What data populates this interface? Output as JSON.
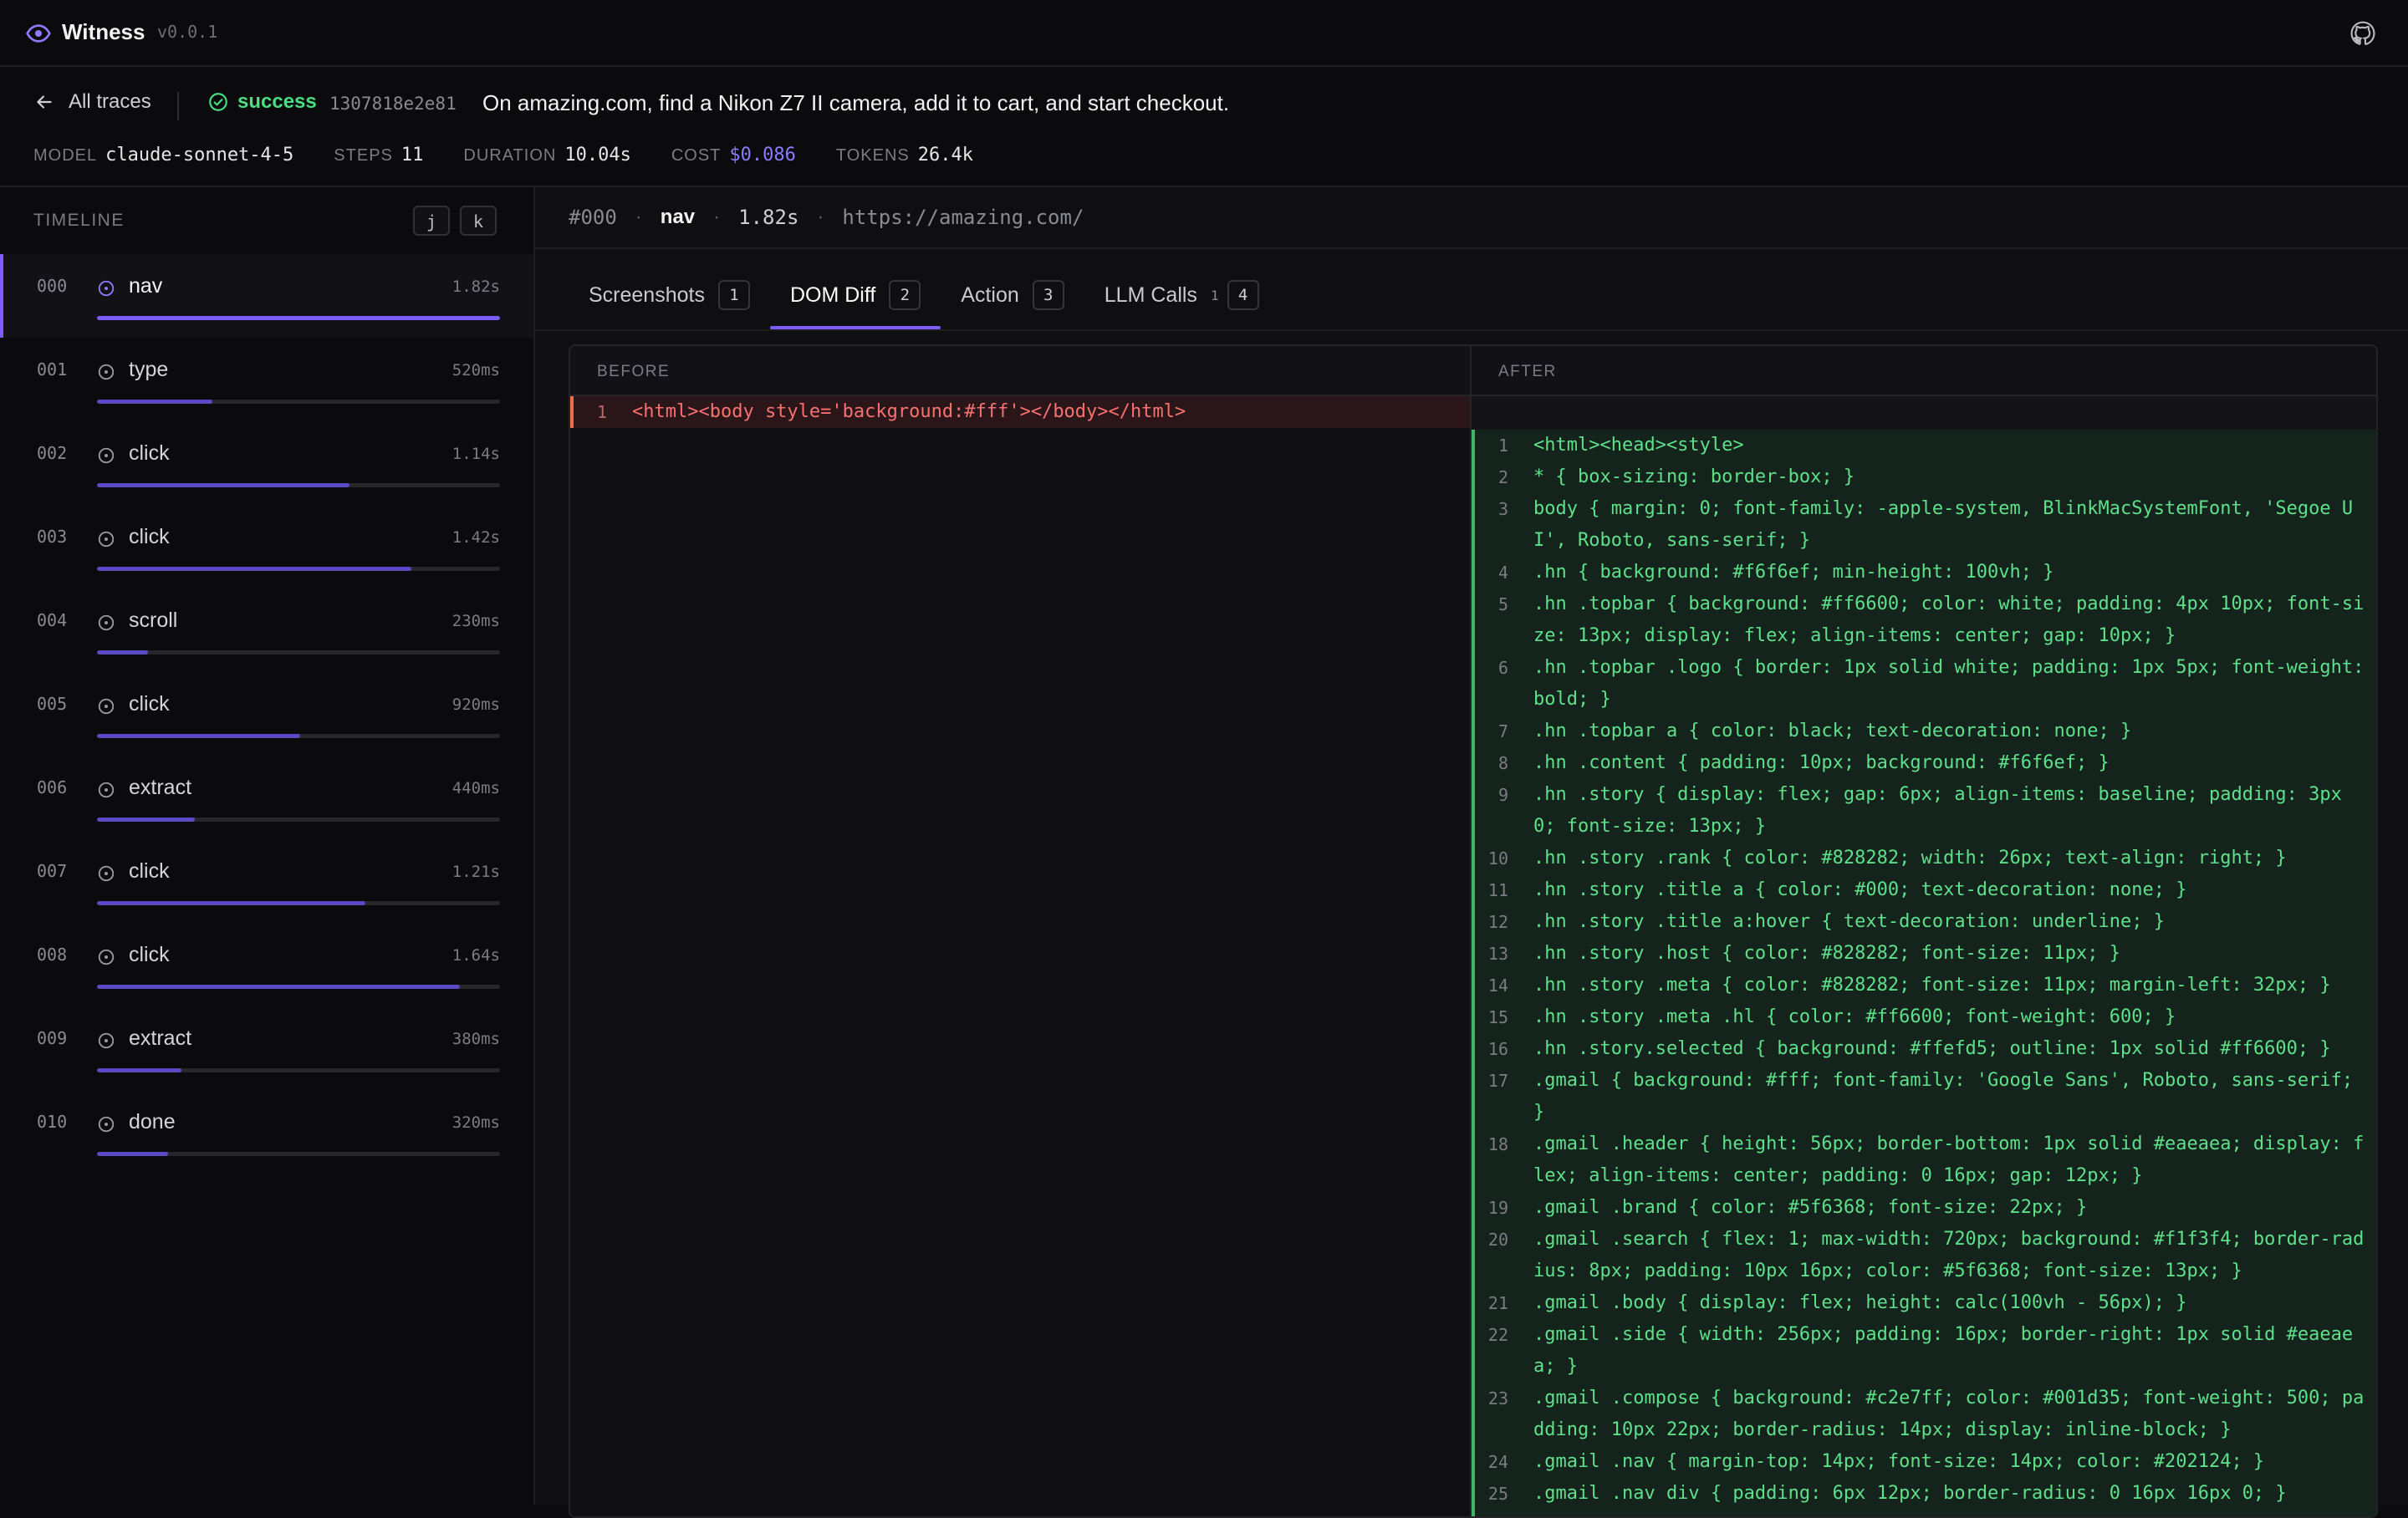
{
  "app": {
    "title": "Witness",
    "version": "v0.0.1"
  },
  "header": {
    "back_label": "All traces",
    "status": "success",
    "trace_id": "1307818e2e81",
    "task": "On amazing.com, find a Nikon Z7 II camera, add it to cart, and start checkout.",
    "stats": {
      "model_key": "MODEL",
      "model": "claude-sonnet-4-5",
      "steps_key": "STEPS",
      "steps": "11",
      "duration_key": "DURATION",
      "duration": "10.04s",
      "cost_key": "COST",
      "cost": "$0.086",
      "tokens_key": "TOKENS",
      "tokens": "26.4k"
    }
  },
  "timeline": {
    "title": "TIMELINE",
    "keys": [
      "j",
      "k"
    ],
    "steps": [
      {
        "index": "000",
        "label": "nav",
        "duration": "1.82s",
        "progress": 1.0
      },
      {
        "index": "001",
        "label": "type",
        "duration": "520ms",
        "progress": 0.286
      },
      {
        "index": "002",
        "label": "click",
        "duration": "1.14s",
        "progress": 0.626
      },
      {
        "index": "003",
        "label": "click",
        "duration": "1.42s",
        "progress": 0.78
      },
      {
        "index": "004",
        "label": "scroll",
        "duration": "230ms",
        "progress": 0.126
      },
      {
        "index": "005",
        "label": "click",
        "duration": "920ms",
        "progress": 0.505
      },
      {
        "index": "006",
        "label": "extract",
        "duration": "440ms",
        "progress": 0.242
      },
      {
        "index": "007",
        "label": "click",
        "duration": "1.21s",
        "progress": 0.665
      },
      {
        "index": "008",
        "label": "click",
        "duration": "1.64s",
        "progress": 0.901
      },
      {
        "index": "009",
        "label": "extract",
        "duration": "380ms",
        "progress": 0.209
      },
      {
        "index": "010",
        "label": "done",
        "duration": "320ms",
        "progress": 0.176
      }
    ]
  },
  "detail": {
    "step_id": "#000",
    "action": "nav",
    "duration": "1.82s",
    "url": "https://amazing.com/",
    "separator": "·",
    "tabs": [
      {
        "label": "Screenshots",
        "badge": "1",
        "sub": ""
      },
      {
        "label": "DOM Diff",
        "badge": "2",
        "sub": ""
      },
      {
        "label": "Action",
        "badge": "3",
        "sub": ""
      },
      {
        "label": "LLM Calls",
        "badge": "4",
        "sub": "1"
      }
    ],
    "diff": {
      "before_label": "BEFORE",
      "after_label": "AFTER",
      "before_lines": [
        {
          "n": "1",
          "code": "<html><body style='background:#fff'></body></html>"
        }
      ],
      "after_lines": [
        {
          "n": "1",
          "code": "<html><head><style>"
        },
        {
          "n": "2",
          "code": "* { box-sizing: border-box; }"
        },
        {
          "n": "3",
          "code": "body { margin: 0; font-family: -apple-system, BlinkMacSystemFont, 'Segoe UI', Roboto, sans-serif; }"
        },
        {
          "n": "4",
          "code": ".hn { background: #f6f6ef; min-height: 100vh; }"
        },
        {
          "n": "5",
          "code": ".hn .topbar { background: #ff6600; color: white; padding: 4px 10px; font-size: 13px; display: flex; align-items: center; gap: 10px; }"
        },
        {
          "n": "6",
          "code": ".hn .topbar .logo { border: 1px solid white; padding: 1px 5px; font-weight: bold; }"
        },
        {
          "n": "7",
          "code": ".hn .topbar a { color: black; text-decoration: none; }"
        },
        {
          "n": "8",
          "code": ".hn .content { padding: 10px; background: #f6f6ef; }"
        },
        {
          "n": "9",
          "code": ".hn .story { display: flex; gap: 6px; align-items: baseline; padding: 3px 0; font-size: 13px; }"
        },
        {
          "n": "10",
          "code": ".hn .story .rank { color: #828282; width: 26px; text-align: right; }"
        },
        {
          "n": "11",
          "code": ".hn .story .title a { color: #000; text-decoration: none; }"
        },
        {
          "n": "12",
          "code": ".hn .story .title a:hover { text-decoration: underline; }"
        },
        {
          "n": "13",
          "code": ".hn .story .host { color: #828282; font-size: 11px; }"
        },
        {
          "n": "14",
          "code": ".hn .story .meta { color: #828282; font-size: 11px; margin-left: 32px; }"
        },
        {
          "n": "15",
          "code": ".hn .story .meta .hl { color: #ff6600; font-weight: 600; }"
        },
        {
          "n": "16",
          "code": ".hn .story.selected { background: #ffefd5; outline: 1px solid #ff6600; }"
        },
        {
          "n": "17",
          "code": ".gmail { background: #fff; font-family: 'Google Sans', Roboto, sans-serif; }"
        },
        {
          "n": "18",
          "code": ".gmail .header { height: 56px; border-bottom: 1px solid #eaeaea; display: flex; align-items: center; padding: 0 16px; gap: 12px; }"
        },
        {
          "n": "19",
          "code": ".gmail .brand { color: #5f6368; font-size: 22px; }"
        },
        {
          "n": "20",
          "code": ".gmail .search { flex: 1; max-width: 720px; background: #f1f3f4; border-radius: 8px; padding: 10px 16px; color: #5f6368; font-size: 13px; }"
        },
        {
          "n": "21",
          "code": ".gmail .body { display: flex; height: calc(100vh - 56px); }"
        },
        {
          "n": "22",
          "code": ".gmail .side { width: 256px; padding: 16px; border-right: 1px solid #eaeaea; }"
        },
        {
          "n": "23",
          "code": ".gmail .compose { background: #c2e7ff; color: #001d35; font-weight: 500; padding: 10px 22px; border-radius: 14px; display: inline-block; }"
        },
        {
          "n": "24",
          "code": ".gmail .nav { margin-top: 14px; font-size: 14px; color: #202124; }"
        },
        {
          "n": "25",
          "code": ".gmail .nav div { padding: 6px 12px; border-radius: 0 16px 16px 0; }"
        }
      ]
    }
  },
  "colors": {
    "accent": "#7c5cff",
    "success": "#4ade80",
    "added": "#5ee08b",
    "removed": "#f87171"
  },
  "icons": {
    "brand": "eye-icon",
    "github": "github-icon",
    "back": "arrow-left-icon",
    "status": "check-circle-icon",
    "step": "clock-icon"
  }
}
